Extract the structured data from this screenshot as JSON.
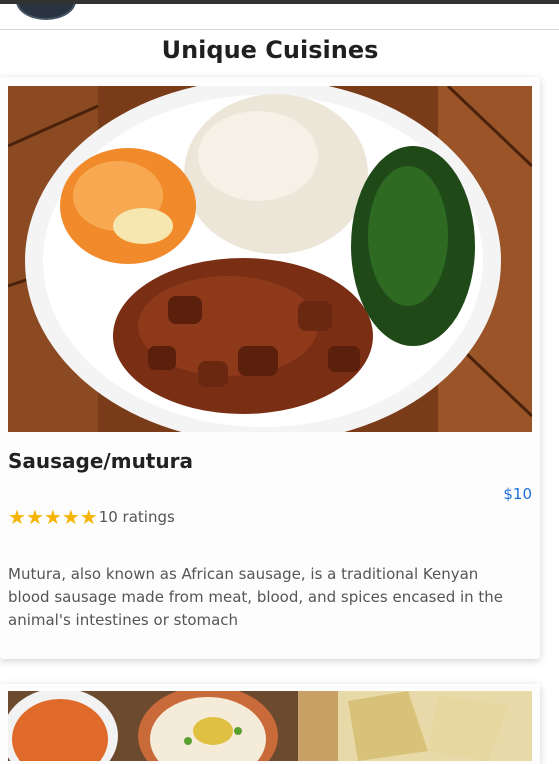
{
  "header": {
    "avatar_icon": "user-avatar-icon"
  },
  "section": {
    "title": "Unique Cuisines"
  },
  "cards": [
    {
      "title": "Sausage/mutura",
      "price": "$10",
      "stars": [
        "★",
        "★",
        "★",
        "★",
        "★"
      ],
      "rating_value": 5,
      "ratings_text": "10 ratings",
      "description": "Mutura, also known as African sausage, is a traditional Kenyan blood sausage made from meat, blood, and spices encased in the animal's intestines or stomach",
      "image_icon": "food-photo-ugali-stew-greens"
    },
    {
      "image_icon": "food-photo-platter"
    }
  ],
  "colors": {
    "price": "#1e6fd9",
    "star": "#f6b400",
    "title": "#1f1f1f",
    "text_muted": "#555555"
  }
}
